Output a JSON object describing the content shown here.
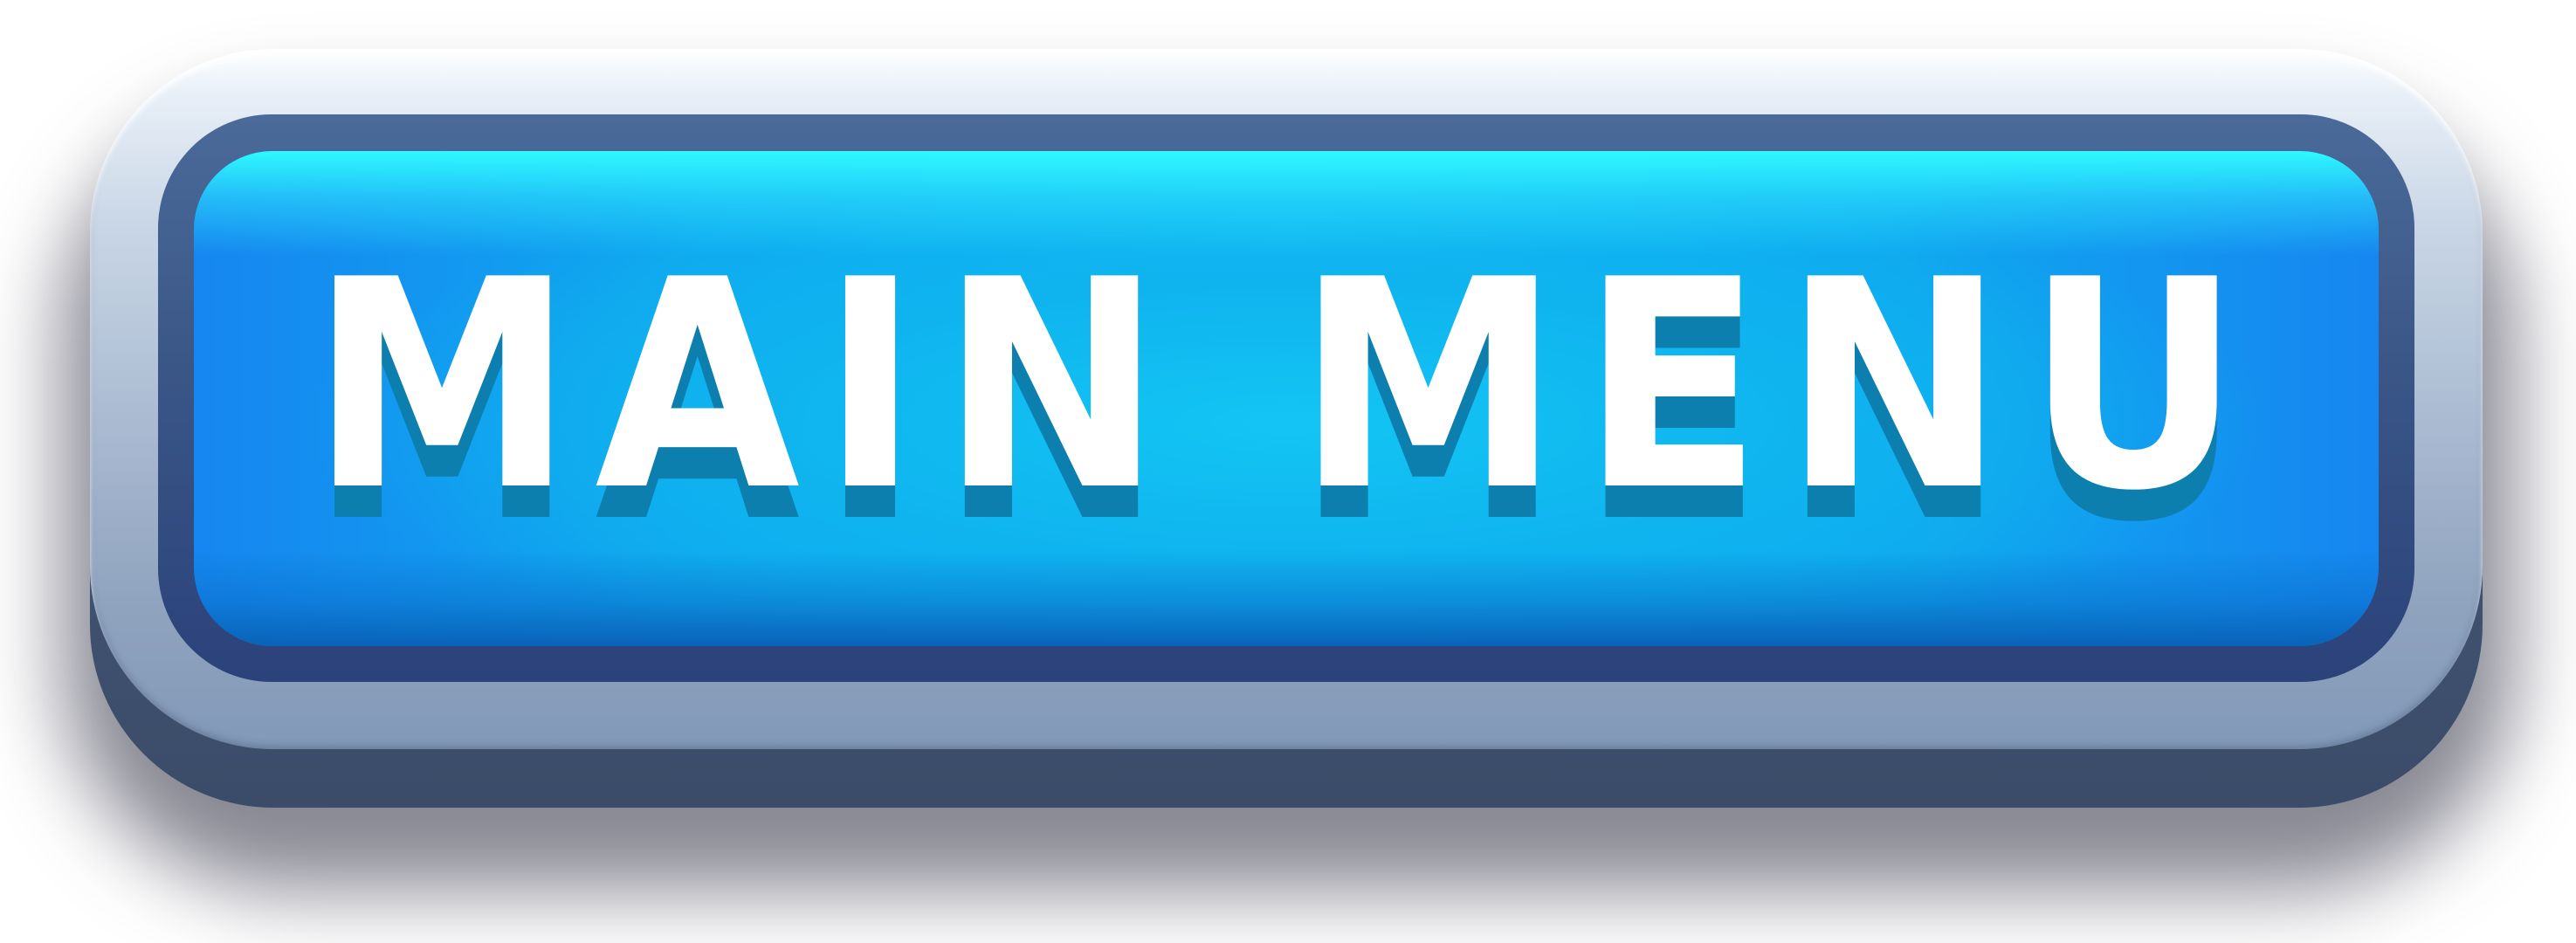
{
  "button": {
    "label": "MAIN MENU"
  },
  "colors": {
    "face_center": "#13c5f4",
    "face_edge": "#1686f0",
    "face_top_glow": "#2ff8ff",
    "navy_ring": "#2b427a",
    "frame_light": "#e9f0f8",
    "frame_dark": "#8299b8",
    "base": "#3a4c68",
    "label_text": "#ffffff",
    "label_shadow": "#0d7fae"
  }
}
